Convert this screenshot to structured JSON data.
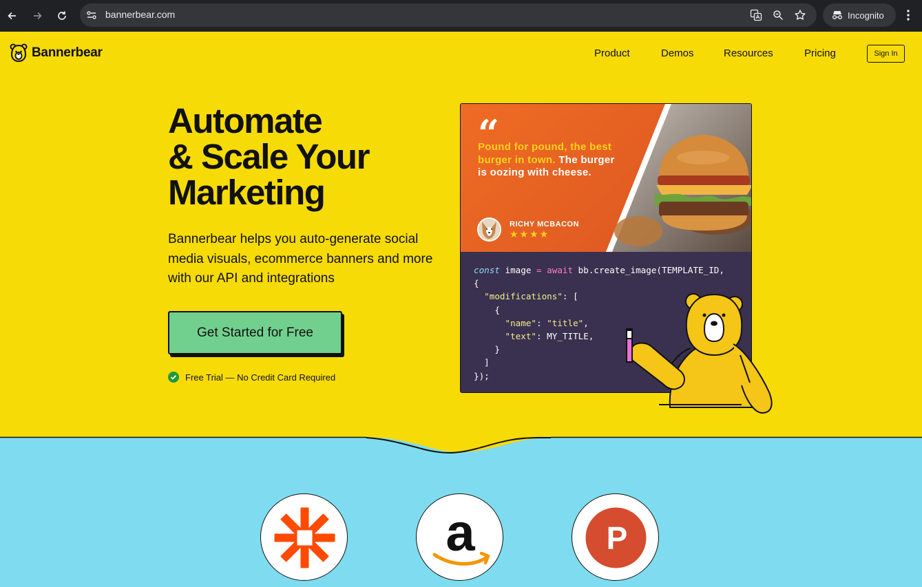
{
  "browser": {
    "url": "bannerbear.com",
    "profile_label": "Incognito"
  },
  "header": {
    "brand": "Bannerbear",
    "nav": [
      "Product",
      "Demos",
      "Resources",
      "Pricing"
    ],
    "signin_label": "Sign In"
  },
  "hero": {
    "headline_lines": [
      "Automate",
      "& Scale Your",
      "Marketing"
    ],
    "subtext": "Bannerbear helps you auto-generate social media visuals, ecommerce banners and more with our API and integrations",
    "cta_label": "Get Started for Free",
    "trial_note": "Free Trial — No Credit Card Required"
  },
  "banner": {
    "quote_highlight": "Pound for pound, the best burger in town.",
    "quote_rest": "The burger is oozing with cheese.",
    "author": "RICHY MCBACON",
    "rating_stars": 4
  },
  "code_sample": {
    "line1_kw": "const",
    "line1_var": " image ",
    "line1_eq": "=",
    "line1_await": " await",
    "line1_call": " bb.create_image(TEMPLATE_ID,",
    "line2": "{",
    "key_mods": "\"modifications\"",
    "line3_tail": ": [",
    "line4": "    {",
    "key_name": "\"name\"",
    "val_name": "\"title\"",
    "key_text": "\"text\"",
    "val_text": " MY_TITLE,",
    "line7": "    }",
    "line8": "  ]",
    "line9": "});"
  },
  "partners": [
    "zapier",
    "amazon",
    "producthunt"
  ],
  "colors": {
    "hero_bg": "#f7db07",
    "lower_bg": "#7fdbef",
    "cta_bg": "#72d08e",
    "banner_orange": "#ef6c24",
    "code_bg": "#39314f"
  }
}
